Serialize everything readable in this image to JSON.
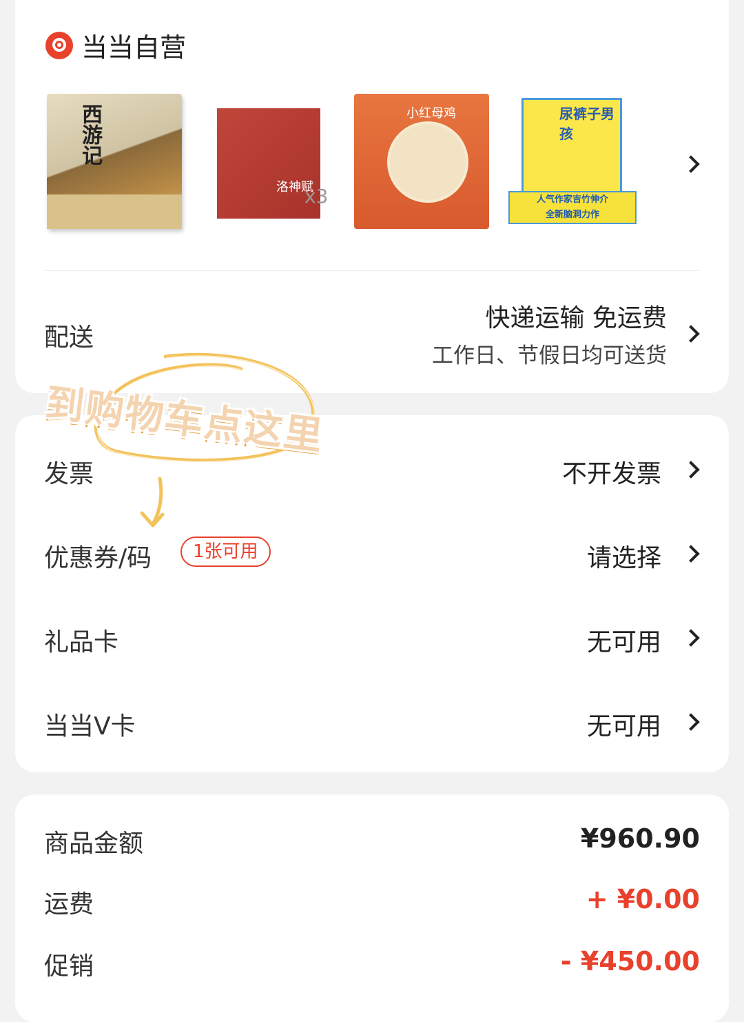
{
  "store": {
    "name": "当当自营"
  },
  "books": [
    {
      "title": "西游记"
    },
    {
      "title": "洛神赋",
      "quantity": "x3"
    },
    {
      "title": "小红母鸡"
    },
    {
      "title": "尿裤子男孩",
      "banner_line1": "人气作家吉竹伸介",
      "banner_line2": "全新脑洞力作"
    }
  ],
  "delivery": {
    "label": "配送",
    "method": "快递运输 免运费",
    "schedule": "工作日、节假日均可送货"
  },
  "annotation": {
    "text": "到购物车点这里"
  },
  "options": [
    {
      "label": "发票",
      "value": "不开发票"
    },
    {
      "label": "优惠券/码",
      "badge": "1张可用",
      "value": "请选择"
    },
    {
      "label": "礼品卡",
      "value": "无可用"
    },
    {
      "label": "当当V卡",
      "value": "无可用"
    }
  ],
  "summary": [
    {
      "label": "商品金额",
      "value": "¥960.90",
      "color": "#222222"
    },
    {
      "label": "运费",
      "value": "+ ¥0.00",
      "color": "#e8412c"
    },
    {
      "label": "促销",
      "value": "- ¥450.00",
      "color": "#e8412c"
    }
  ]
}
